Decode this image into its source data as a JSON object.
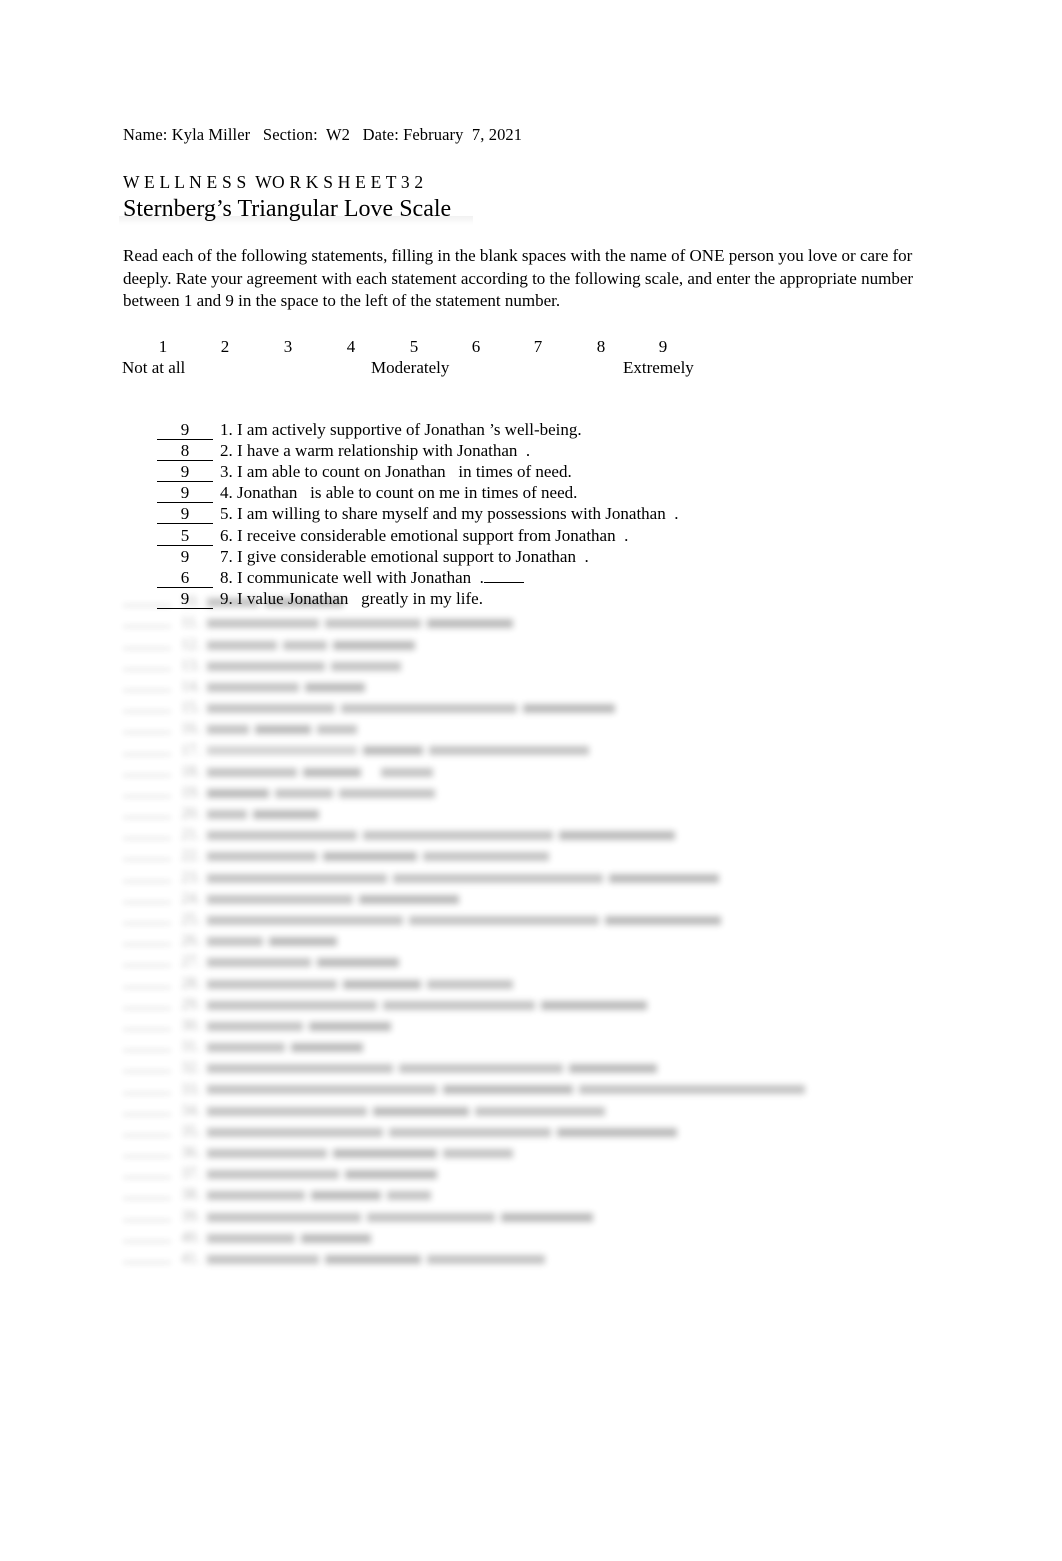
{
  "document": {
    "meta_line": "Name: Kyla Miller   Section:  W2   Date: February  7, 2021",
    "worksheet_label": "W E L L N E S S  WO R K S H E E T 3 2",
    "title": "Sternberg’s Triangular Love Scale",
    "instructions": "Read each of the following statements, filling in the blank spaces with the name of ONE person you love or care for deeply. Rate your agreement with each statement according to the following scale, and enter the appropriate number between 1 and 9 in the space to the left of the statement number."
  },
  "scale": {
    "numbers": [
      "1",
      "2",
      "3",
      "4",
      "5",
      "6",
      "7",
      "8",
      "9"
    ],
    "label_low": "Not at all",
    "label_mid": "Moderately",
    "label_high": "Extremely"
  },
  "statements": [
    {
      "answer": "9",
      "number": "1.",
      "text": "I am actively supportive of Jonathan ’s well-being."
    },
    {
      "answer": "8",
      "number": "2.",
      "text": "I have a warm relationship with Jonathan  ."
    },
    {
      "answer": "9",
      "number": "3.",
      "text": "I am able to count on Jonathan   in times of need."
    },
    {
      "answer": "9",
      "number": "4.",
      "text": "Jonathan   is able to count on me in times of need."
    },
    {
      "answer": "9",
      "number": "5.",
      "text": "I am willing to share myself and my possessions with Jonathan  ."
    },
    {
      "answer": "5",
      "number": "6.",
      "text": "I receive considerable emotional support from Jonathan  ."
    },
    {
      "answer": "9",
      "number": "7.",
      "text": "I give considerable emotional support to Jonathan  ."
    },
    {
      "answer": "6",
      "number": "8.",
      "text": "I communicate well with Jonathan  ."
    },
    {
      "answer": "9",
      "number": "9.",
      "text": "I value Jonathan   greatly in my life."
    }
  ],
  "obscured_note": "Remaining statements are visually blurred and unreadable in the source image."
}
